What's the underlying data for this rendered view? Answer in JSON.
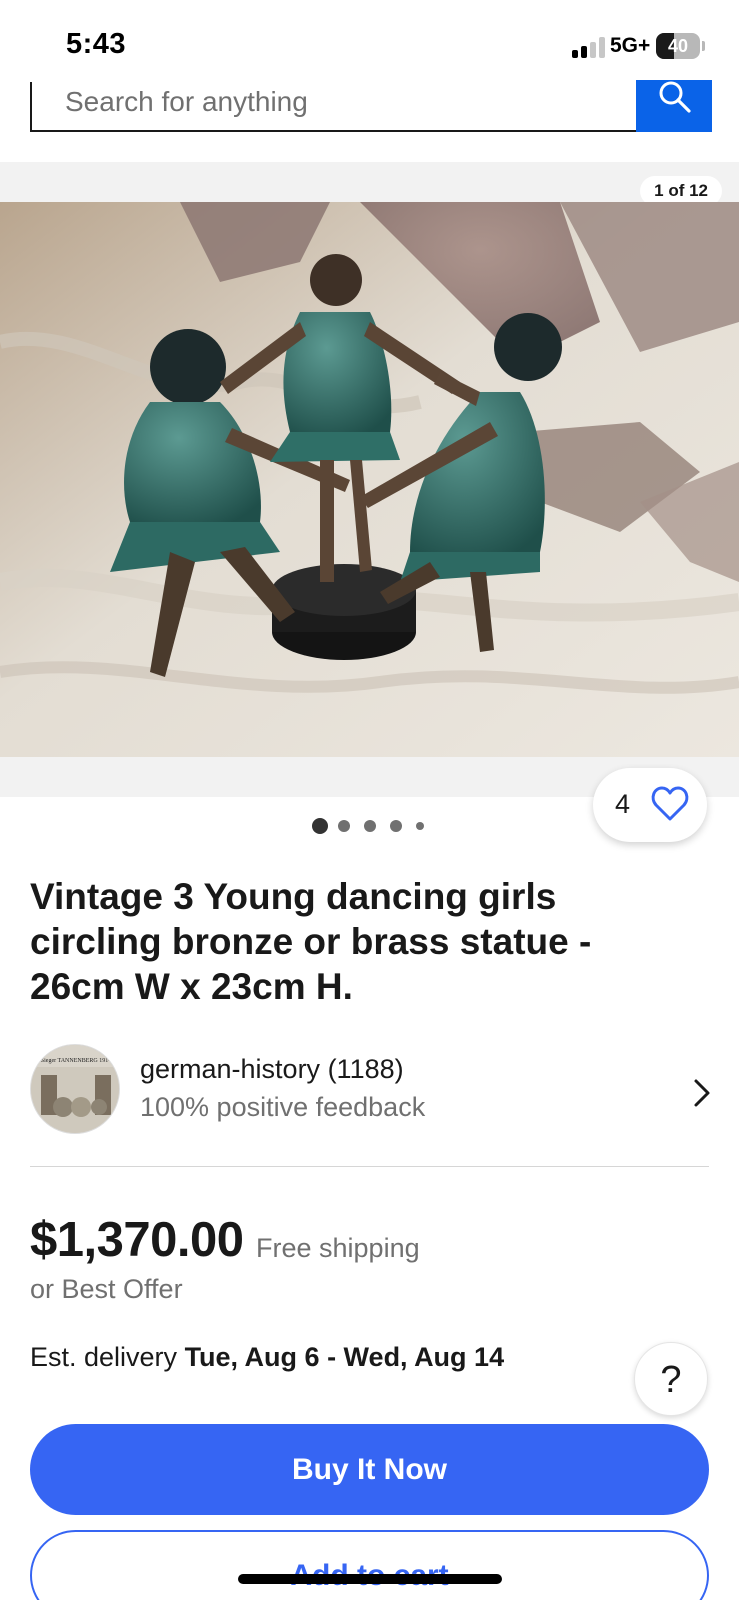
{
  "status_bar": {
    "time": "5:43",
    "network": "5G+",
    "battery_level": "40",
    "battery_fraction": 0.4,
    "signal_bars_active": 2,
    "signal_bars_total": 4
  },
  "search": {
    "placeholder": "Search for anything"
  },
  "gallery": {
    "counter": "1 of 12",
    "dot_count": 5,
    "active_dot": 0,
    "watchers": "4"
  },
  "listing": {
    "title": "Vintage 3 Young dancing girls circling bronze or brass statue - 26cm W x 23cm H."
  },
  "seller": {
    "name": "german-history (1188)",
    "feedback": "100% positive feedback",
    "avatar_caption": "Sieger TANNENBERG 1914"
  },
  "pricing": {
    "price": "$1,370.00",
    "shipping": "Free shipping",
    "offer": "or Best Offer"
  },
  "delivery": {
    "label": "Est. delivery ",
    "dates": "Tue, Aug 6 - Wed, Aug 14"
  },
  "help": {
    "label": "?"
  },
  "actions": {
    "buy_now": "Buy It Now",
    "add_to_cart": "Add to cart"
  },
  "colors": {
    "accent_blue": "#3665f3",
    "search_blue": "#0a63e8",
    "text_primary": "#191919",
    "text_secondary": "#707070"
  }
}
